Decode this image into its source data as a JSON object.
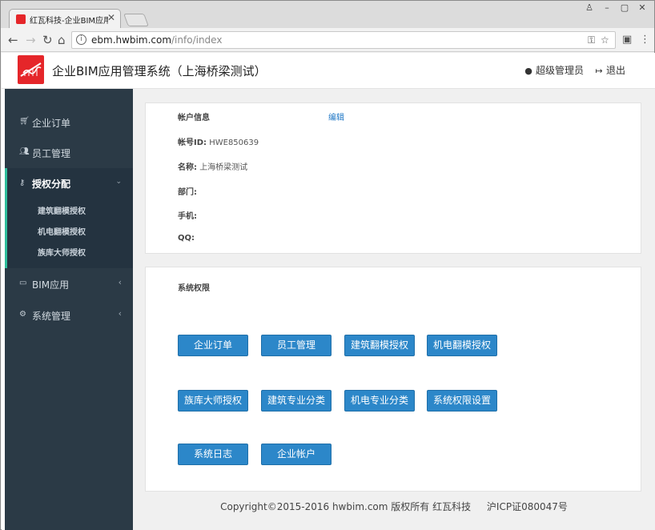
{
  "browser": {
    "tab_title": "红瓦科技-企业BIM应用管",
    "url_host": "ebm.hwbim.com",
    "url_path": "/info/index"
  },
  "header": {
    "brand": "企业BIM应用管理系统（上海桥梁测试）",
    "user": "超级管理员",
    "logout": "退出"
  },
  "sidebar": {
    "items": [
      {
        "label": "企业订单",
        "icon": "cart-icon"
      },
      {
        "label": "员工管理",
        "icon": "users-icon"
      },
      {
        "label": "授权分配",
        "icon": "key-icon"
      },
      {
        "label": "BIM应用",
        "icon": "monitor-icon"
      },
      {
        "label": "系统管理",
        "icon": "gear-icon"
      }
    ],
    "sub_items": [
      "建筑翻模授权",
      "机电翻模授权",
      "族库大师授权"
    ]
  },
  "account": {
    "title": "帐户信息",
    "edit": "编辑",
    "id_label": "帐号ID:",
    "id_value": "HWE850639",
    "name_label": "名称:",
    "name_value": "上海桥梁测试",
    "dept_label": "部门:",
    "phone_label": "手机:",
    "qq_label": "QQ:"
  },
  "permissions": {
    "title": "系统权限",
    "buttons": [
      "企业订单",
      "员工管理",
      "建筑翻模授权",
      "机电翻模授权",
      "族库大师授权",
      "建筑专业分类",
      "机电专业分类",
      "系统权限设置",
      "系统日志",
      "企业帐户"
    ]
  },
  "footer": {
    "copyright": "Copyright©2015-2016 hwbim.com 版权所有 红瓦科技",
    "icp": "沪ICP证080047号"
  }
}
